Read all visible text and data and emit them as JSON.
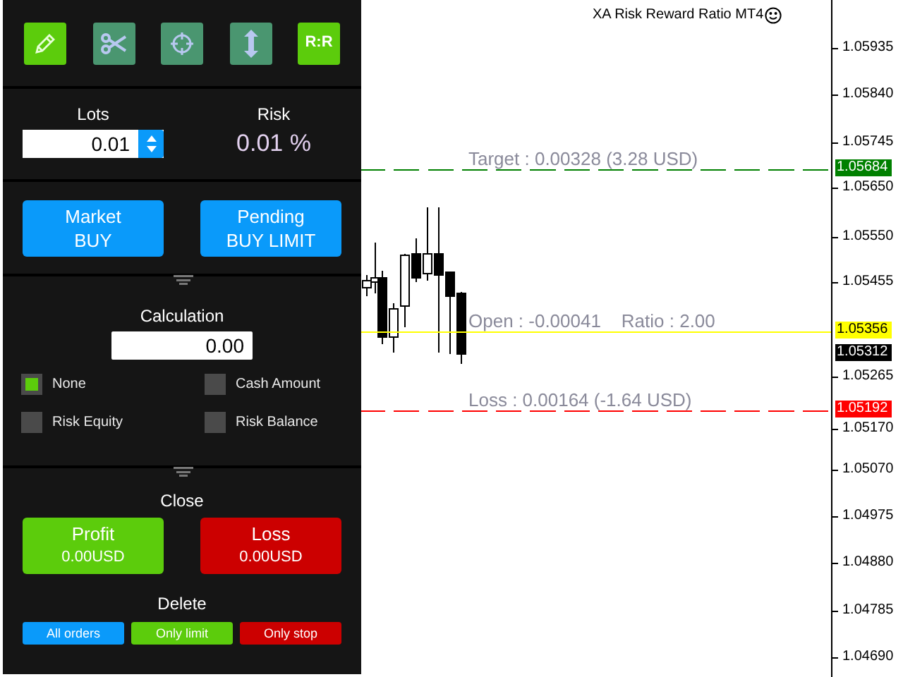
{
  "toolbar": [
    {
      "kind": "pencil",
      "selected": true
    },
    {
      "kind": "scissors",
      "selected": false
    },
    {
      "kind": "crosshair",
      "selected": false
    },
    {
      "kind": "updown",
      "selected": false
    },
    {
      "kind": "text",
      "label": "R:R",
      "selected": true
    }
  ],
  "lots": {
    "label": "Lots",
    "value": "0.01"
  },
  "risk": {
    "label": "Risk",
    "value": "0.01 %"
  },
  "order_buttons": [
    {
      "line1": "Market",
      "line2": "BUY"
    },
    {
      "line1": "Pending",
      "line2": "BUY LIMIT"
    }
  ],
  "calculation": {
    "label": "Calculation",
    "value": "0.00"
  },
  "options": [
    {
      "label": "None",
      "checked": true
    },
    {
      "label": "Cash Amount",
      "checked": false
    },
    {
      "label": "Risk Equity",
      "checked": false
    },
    {
      "label": "Risk Balance",
      "checked": false
    }
  ],
  "close": {
    "label": "Close",
    "buttons": [
      {
        "line1": "Profit",
        "line2": "0.00USD",
        "color": "#5ccc0c"
      },
      {
        "line1": "Loss",
        "line2": "0.00USD",
        "color": "#cc0000"
      }
    ]
  },
  "delete": {
    "label": "Delete",
    "buttons": [
      {
        "label": "All orders",
        "color": "#0a9afa"
      },
      {
        "label": "Only limit",
        "color": "#5ccc0c"
      },
      {
        "label": "Only stop",
        "color": "#cc0000"
      }
    ]
  },
  "chart": {
    "title": "XA Risk Reward Ratio MT4",
    "levels": [
      {
        "kind": "target",
        "text": "Target : 0.00328 (3.28 USD)",
        "color": "#008000",
        "tag": "1.05684"
      },
      {
        "kind": "open",
        "text": "Open : -0.00041    Ratio : 2.00",
        "color": "#ffff00",
        "tag": "1.05356"
      },
      {
        "kind": "loss",
        "text": "Loss : 0.00164 (-1.64 USD)",
        "color": "#ff0000",
        "tag": "1.05192"
      }
    ],
    "bid_tag": "1.05312",
    "axis_ticks": [
      "1.05935",
      "1.05840",
      "1.05745",
      "1.05650",
      "1.05550",
      "1.05455",
      "1.05265",
      "1.05170",
      "1.05070",
      "1.04975",
      "1.04880",
      "1.04785",
      "1.04690"
    ]
  }
}
